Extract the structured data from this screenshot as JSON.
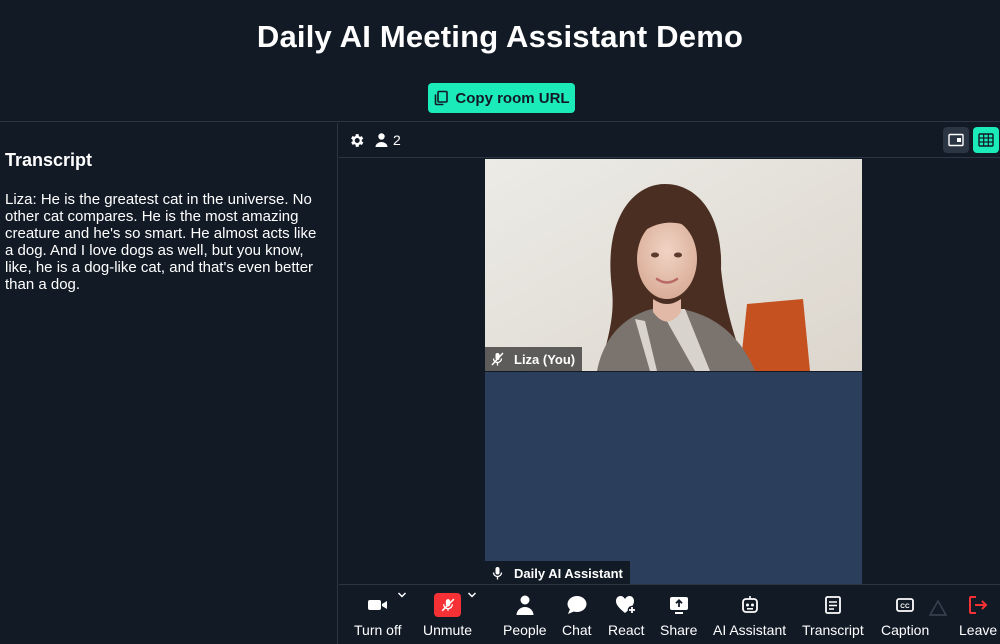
{
  "header": {
    "title": "Daily AI Meeting Assistant Demo",
    "copy_button": "Copy room URL"
  },
  "transcript": {
    "title": "Transcript",
    "text": "Liza: He is the greatest cat in the universe. No other cat compares. He is the most amazing creature and he's so smart. He almost acts like a dog. And I love dogs as well, but you know, like, he is a dog-like cat, and that's even better than a dog."
  },
  "call": {
    "participant_count": "2",
    "tiles": [
      {
        "name": "Liza (You)",
        "muted": true
      },
      {
        "name": "Daily AI Assistant",
        "muted": false
      }
    ]
  },
  "tray": {
    "camera": "Turn off",
    "mic": "Unmute",
    "people": "People",
    "chat": "Chat",
    "react": "React",
    "share": "Share",
    "ai_assistant": "AI Assistant",
    "transcript": "Transcript",
    "caption": "Caption",
    "leave": "Leave"
  },
  "colors": {
    "background": "#121a26",
    "accent": "#1bebb9",
    "tile_empty": "#2b3f5c",
    "danger": "#f63135"
  },
  "icons": [
    "copy-icon",
    "gear-icon",
    "person-icon",
    "speaker-view-icon",
    "grid-view-icon",
    "mic-off-icon",
    "mic-icon",
    "camera-icon",
    "chevron-down-icon",
    "people-icon",
    "chat-icon",
    "react-icon",
    "share-icon",
    "ai-assistant-icon",
    "transcript-icon",
    "caption-icon",
    "leave-icon"
  ]
}
